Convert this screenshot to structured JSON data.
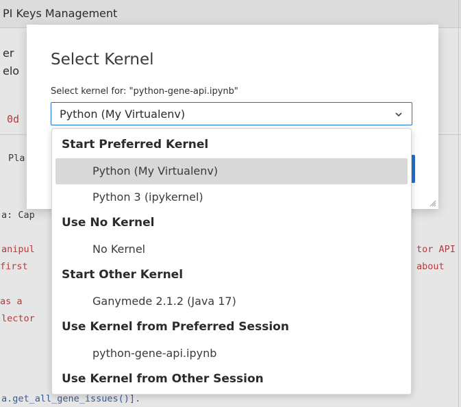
{
  "background": {
    "header_text": "PI Keys Management",
    "left_lines": [
      "er",
      "elo"
    ],
    "code_0d": "0d",
    "code_pla": "Pla",
    "code_cap": "a: Cap",
    "code_manip": "anipul",
    "code_tor_api": "tor API",
    "code_first": " first",
    "code_about": "about",
    "code_as_a": " as a",
    "code_lector": "lector",
    "code_bottom": "a.get_all_gene_issues()]."
  },
  "modal": {
    "title": "Select Kernel",
    "label": "Select kernel for: \"python-gene-api.ipynb\"",
    "selected_value": "Python (My Virtualenv)"
  },
  "dropdown": {
    "items": [
      {
        "type": "group",
        "label": "Start Preferred Kernel"
      },
      {
        "type": "option",
        "label": "Python (My Virtualenv)",
        "selected": true
      },
      {
        "type": "option",
        "label": "Python 3 (ipykernel)"
      },
      {
        "type": "group",
        "label": "Use No Kernel"
      },
      {
        "type": "option",
        "label": "No Kernel"
      },
      {
        "type": "group",
        "label": "Start Other Kernel"
      },
      {
        "type": "option",
        "label": "Ganymede 2.1.2 (Java 17)"
      },
      {
        "type": "group",
        "label": "Use Kernel from Preferred Session"
      },
      {
        "type": "option",
        "label": "python-gene-api.ipynb"
      },
      {
        "type": "group",
        "label": "Use Kernel from Other Session"
      }
    ]
  },
  "colors": {
    "accent": "#1e6fd1",
    "selected_bg": "#d8d8d8"
  }
}
